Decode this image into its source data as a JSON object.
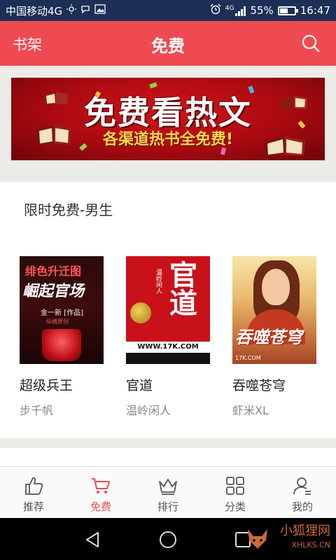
{
  "status_bar": {
    "carrier": "中国移动4G",
    "network": "4G",
    "battery_percent": "55%",
    "battery_level": 0.55,
    "time": "16:47",
    "icons": [
      "brightness-icon",
      "chat-icon",
      "image-icon",
      "alarm-icon",
      "signal-icon",
      "battery-icon"
    ]
  },
  "header": {
    "left_label": "书架",
    "title": "免费",
    "right_icon": "search-icon"
  },
  "banner": {
    "title": "免费看热文",
    "subtitle": "各渠道热书全免费!"
  },
  "section": {
    "title": "限时免费-男生",
    "books": [
      {
        "name": "超级兵王",
        "author": "步千帆",
        "cover_text": [
          "绯色升迁图",
          "崛起官场",
          "金一新 [作品]",
          "纵横原创"
        ]
      },
      {
        "name": "官道",
        "author": "温岭闲人",
        "cover_text": [
          "官道",
          "温岭闲人",
          "WWW.17K.COM"
        ]
      },
      {
        "name": "吞噬苍穹",
        "author": "虾米XL",
        "cover_text": [
          "吞噬苍穹",
          "17K.COM"
        ]
      }
    ]
  },
  "bottom_nav": {
    "items": [
      {
        "label": "推荐",
        "icon": "thumbs-up-icon",
        "active": false
      },
      {
        "label": "免费",
        "icon": "cart-icon",
        "active": true
      },
      {
        "label": "排行",
        "icon": "crown-icon",
        "active": false
      },
      {
        "label": "分类",
        "icon": "grid-icon",
        "active": false
      },
      {
        "label": "我的",
        "icon": "user-icon",
        "active": false
      }
    ]
  },
  "system_nav": {
    "buttons": [
      "back-icon",
      "home-icon",
      "recents-icon"
    ]
  },
  "watermark": {
    "text": "小狐狸网",
    "url": "XHLKS.CN"
  },
  "colors": {
    "accent": "#ef4a52",
    "status_bar": "#1c2f55",
    "background": "#ebebe8"
  }
}
